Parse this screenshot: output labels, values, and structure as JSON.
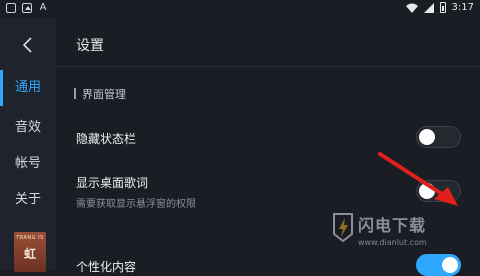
{
  "statusbar": {
    "time": "3:17"
  },
  "sidebar": {
    "items": [
      {
        "label": "通用",
        "active": true
      },
      {
        "label": "音效",
        "active": false
      },
      {
        "label": "帐号",
        "active": false
      },
      {
        "label": "关于",
        "active": false
      }
    ],
    "album": {
      "small_text": "TRANG IS",
      "big_text": "虹"
    }
  },
  "main": {
    "title": "设置",
    "section_title": "界面管理",
    "rows": [
      {
        "label": "隐藏状态栏",
        "sublabel": "",
        "toggle_on": false
      },
      {
        "label": "显示桌面歌词",
        "sublabel": "需要获取显示悬浮窗的权限",
        "toggle_on": false
      },
      {
        "label": "个性化内容",
        "sublabel": "",
        "toggle_on": true
      }
    ]
  },
  "watermark": {
    "title": "闪电下载",
    "url": "www.dianlut.com"
  },
  "colors": {
    "accent": "#2ea8ff",
    "arrow": "#e0201a",
    "background": "#1a1d24"
  }
}
